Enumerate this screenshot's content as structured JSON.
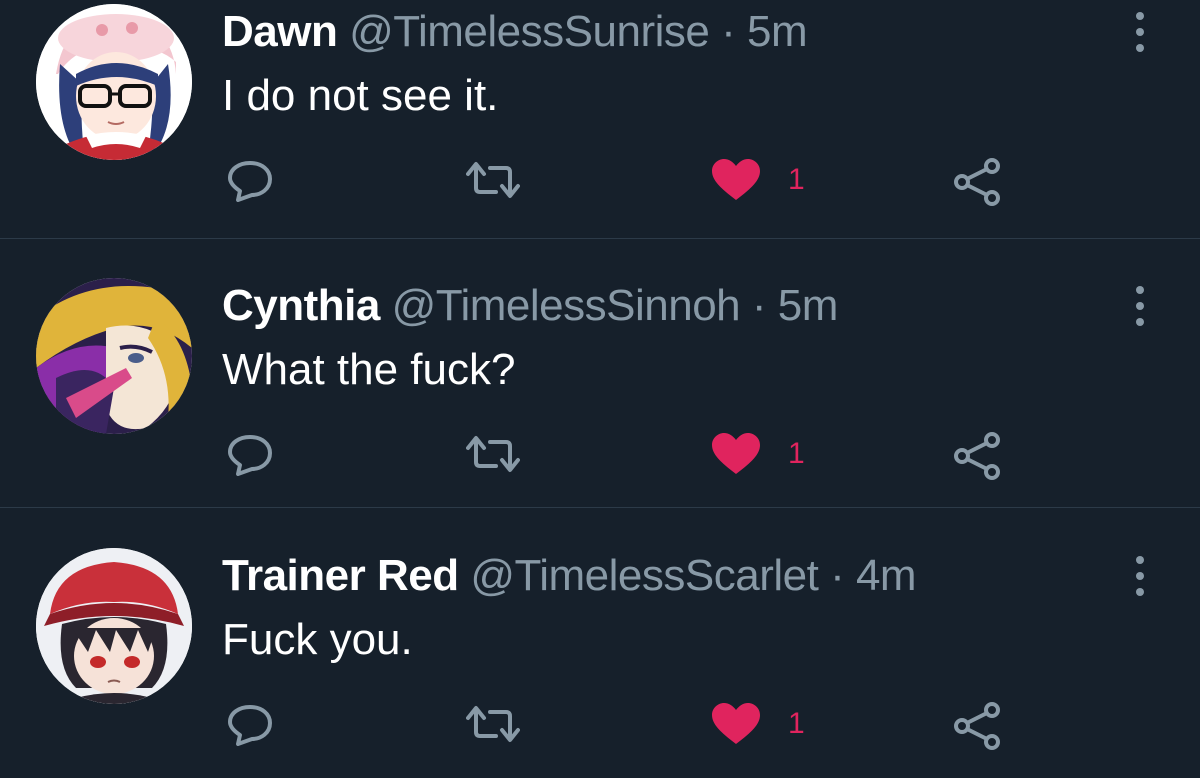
{
  "tweets": [
    {
      "display_name": "Dawn",
      "handle": "@TimelessSunrise",
      "separator": "·",
      "time": "5m",
      "text": "I do not see it.",
      "like_count": "1",
      "avatar": "anime-girl-glasses-pink-hat-avatar"
    },
    {
      "display_name": "Cynthia",
      "handle": "@TimelessSinnoh",
      "separator": "·",
      "time": "5m",
      "text": "What the fuck?",
      "like_count": "1",
      "avatar": "anime-woman-blonde-hair-avatar"
    },
    {
      "display_name": "Trainer Red",
      "handle": "@TimelessScarlet",
      "separator": "·",
      "time": "4m",
      "text": "Fuck you.",
      "like_count": "1",
      "avatar": "anime-boy-red-cap-avatar"
    }
  ],
  "icons": {
    "reply": "reply-icon",
    "retweet": "retweet-icon",
    "like": "heart-icon",
    "share": "share-icon",
    "more": "more-vertical-icon"
  },
  "colors": {
    "background": "#16202b",
    "secondary_text": "#8899a6",
    "like": "#e0245e",
    "divider": "#2c3a48"
  }
}
